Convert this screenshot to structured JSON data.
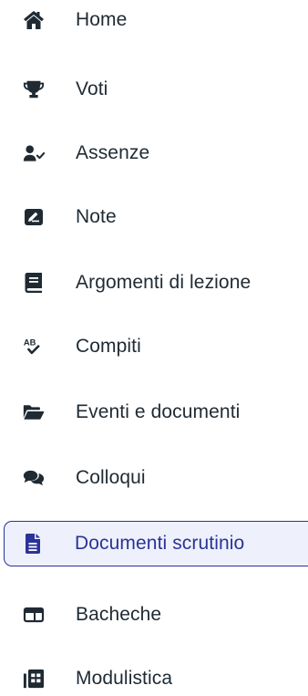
{
  "colors": {
    "icon": "#1f2a33",
    "text": "#1f2a33",
    "accent": "#2b3399",
    "active_bg": "#eef0fb"
  },
  "sidebar": {
    "items": [
      {
        "label": "Home",
        "icon": "home-icon",
        "active": false
      },
      {
        "label": "Voti",
        "icon": "trophy-icon",
        "active": false
      },
      {
        "label": "Assenze",
        "icon": "user-check-icon",
        "active": false
      },
      {
        "label": "Note",
        "icon": "note-icon",
        "active": false
      },
      {
        "label": "Argomenti di lezione",
        "icon": "book-icon",
        "active": false
      },
      {
        "label": "Compiti",
        "icon": "spellcheck-icon",
        "active": false
      },
      {
        "label": "Eventi e documenti",
        "icon": "folder-open-icon",
        "active": false
      },
      {
        "label": "Colloqui",
        "icon": "comments-icon",
        "active": false
      },
      {
        "label": "Documenti scrutinio",
        "icon": "document-icon",
        "active": true
      },
      {
        "label": "Bacheche",
        "icon": "board-icon",
        "active": false
      },
      {
        "label": "Modulistica",
        "icon": "forms-icon",
        "active": false
      }
    ]
  }
}
